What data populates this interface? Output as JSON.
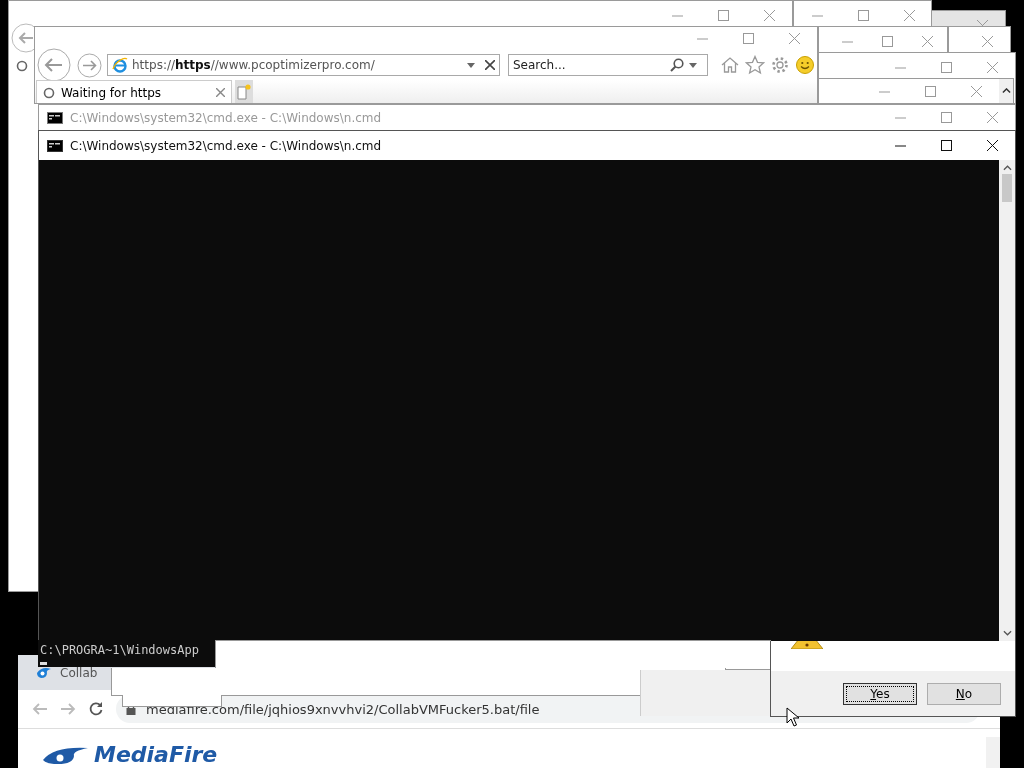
{
  "window_frames": [
    {
      "dimmed": false
    },
    {
      "dimmed": false
    },
    {
      "dimmed": true
    },
    {
      "dimmed": false
    },
    {
      "dimmed": false
    },
    {
      "dimmed": false
    },
    {
      "dimmed": false
    }
  ],
  "browser": {
    "address": "https://**https**//www.pcoptimizerpro.com/",
    "search": {
      "placeholder": "Search..."
    },
    "tab": {
      "title": "Waiting for https",
      "loading": true,
      "selected": true
    }
  },
  "consoles": [
    {
      "title": "C:\\Windows\\system32\\cmd.exe - C:\\Windows\\n.cmd",
      "active": false
    },
    {
      "title": "C:\\Windows\\system32\\cmd.exe - C:\\Windows\\n.cmd",
      "active": true
    }
  ],
  "console_fragment": "C:\\PROGRA~1\\WindowsApp",
  "chrome": {
    "tab": {
      "title": "Collab"
    },
    "url": "mediafire.com/file/jqhios9xnvvhvi2/CollabVMFucker5.bat/file",
    "logo": "MediaFire"
  },
  "dialog": {
    "buttons": [
      {
        "label": "Yes",
        "focused": true
      },
      {
        "label": "No",
        "focused": false
      }
    ]
  }
}
